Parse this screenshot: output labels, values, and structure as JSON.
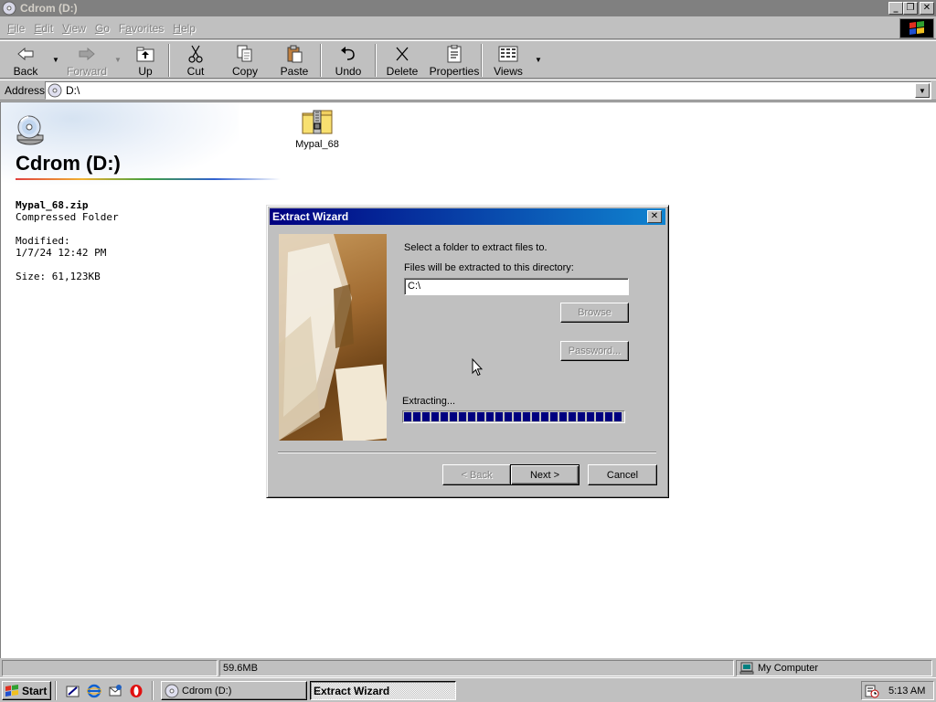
{
  "window": {
    "title": "Cdrom (D:)",
    "caption_buttons": {
      "minimize": "_",
      "maximize": "❐",
      "close": "✕"
    }
  },
  "menu": {
    "items": [
      {
        "label": "File",
        "u": "F",
        "rest": "ile"
      },
      {
        "label": "Edit",
        "u": "E",
        "rest": "dit"
      },
      {
        "label": "View",
        "u": "V",
        "rest": "iew"
      },
      {
        "label": "Go",
        "u": "G",
        "rest": "o"
      },
      {
        "label": "Favorites",
        "u": "a",
        "pre": "F",
        "rest": "vorites"
      },
      {
        "label": "Help",
        "u": "H",
        "rest": "elp"
      }
    ]
  },
  "toolbar": {
    "back": "Back",
    "forward": "Forward",
    "up": "Up",
    "cut": "Cut",
    "copy": "Copy",
    "paste": "Paste",
    "undo": "Undo",
    "delete": "Delete",
    "properties": "Properties",
    "views": "Views"
  },
  "address": {
    "label": "Address",
    "value": "D:\\"
  },
  "folder_view": {
    "title": "Cdrom (D:)",
    "details": {
      "file_name": "Mypal_68.zip",
      "file_type": "Compressed Folder",
      "modified_label": "Modified:",
      "modified_value": "1/7/24 12:42 PM",
      "size": "Size: 61,123KB"
    },
    "items": [
      {
        "label": "Mypal_68",
        "icon": "zip-folder-icon"
      }
    ]
  },
  "dialog": {
    "title": "Extract Wizard",
    "prompt": "Select a folder to extract files to.",
    "dir_label": "Files will be extracted to this directory:",
    "dir_value": "C:\\",
    "browse": "Browse",
    "password": "Password...",
    "extracting": "Extracting...",
    "progress": 1.0,
    "back": "< Back",
    "next": "Next >",
    "cancel": "Cancel"
  },
  "statusbar": {
    "panel1": "",
    "panel2": "59.6MB",
    "panel3": "My Computer"
  },
  "taskbar": {
    "start": "Start",
    "tasks": [
      {
        "label": "Cdrom (D:)",
        "active": false
      },
      {
        "label": "Extract Wizard",
        "active": true
      }
    ],
    "clock": "5:13 AM"
  },
  "colors": {
    "window_bg": "#c0c0c0",
    "active_title_start": "#000080",
    "active_title_end": "#1084d0",
    "inactive_title": "#808080",
    "progress": "#000080"
  }
}
